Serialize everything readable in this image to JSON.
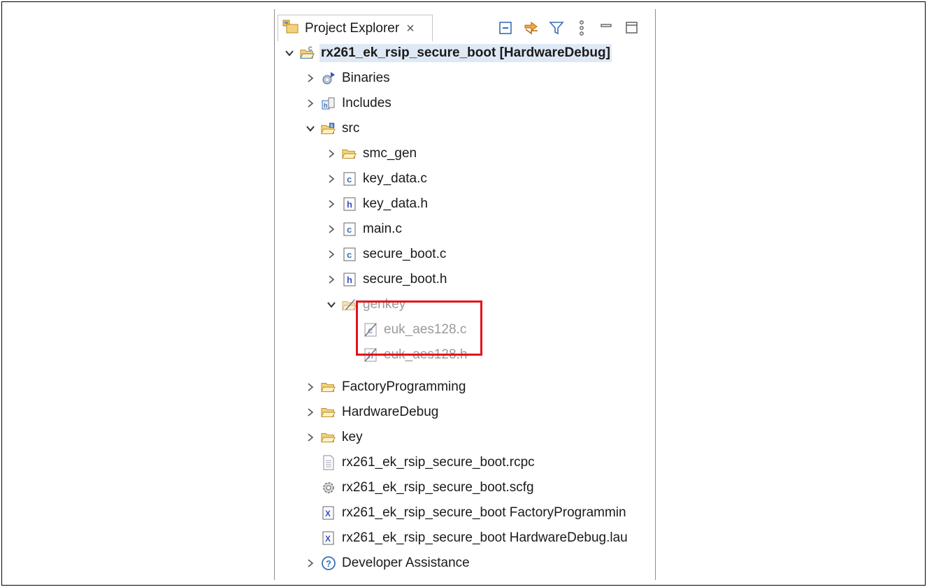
{
  "panel": {
    "tab_title": "Project Explorer",
    "close_glyph": "×",
    "toolbar_icons": [
      "collapse-all-icon",
      "link-with-editor-icon",
      "filter-icon",
      "view-menu-icon",
      "minimize-icon",
      "maximize-icon"
    ]
  },
  "tree": {
    "items": [
      {
        "label": "rx261_ek_rsip_secure_boot [HardwareDebug]",
        "icon": "c-project-icon",
        "expanded": true,
        "selected": true
      },
      {
        "label": "Binaries",
        "icon": "binaries-icon",
        "expanded": false
      },
      {
        "label": "Includes",
        "icon": "includes-icon",
        "expanded": false
      },
      {
        "label": "src",
        "icon": "source-folder-icon",
        "expanded": true
      },
      {
        "label": "smc_gen",
        "icon": "folder-icon",
        "expanded": false
      },
      {
        "label": "key_data.c",
        "icon": "c-file-icon",
        "expanded": false
      },
      {
        "label": "key_data.h",
        "icon": "h-file-icon",
        "expanded": false
      },
      {
        "label": "main.c",
        "icon": "c-file-icon",
        "expanded": false
      },
      {
        "label": "secure_boot.c",
        "icon": "c-file-icon",
        "expanded": false
      },
      {
        "label": "secure_boot.h",
        "icon": "h-file-icon",
        "expanded": false
      },
      {
        "label": "genkey",
        "icon": "excluded-folder-icon",
        "expanded": true,
        "faded": true
      },
      {
        "label": "euk_aes128.c",
        "icon": "excluded-c-file-icon",
        "faded": true
      },
      {
        "label": "euk_aes128.h",
        "icon": "excluded-h-file-icon",
        "faded": true
      },
      {
        "label": "FactoryProgramming",
        "icon": "folder-icon",
        "expanded": false
      },
      {
        "label": "HardwareDebug",
        "icon": "folder-icon",
        "expanded": false
      },
      {
        "label": "key",
        "icon": "folder-icon",
        "expanded": false
      },
      {
        "label": "rx261_ek_rsip_secure_boot.rcpc",
        "icon": "text-file-icon"
      },
      {
        "label": "rx261_ek_rsip_secure_boot.scfg",
        "icon": "config-gear-icon"
      },
      {
        "label": "rx261_ek_rsip_secure_boot FactoryProgrammin",
        "icon": "launch-file-icon"
      },
      {
        "label": "rx261_ek_rsip_secure_boot HardwareDebug.lau",
        "icon": "launch-file-icon"
      },
      {
        "label": "Developer Assistance",
        "icon": "help-icon",
        "expanded": false
      }
    ]
  },
  "colors": {
    "highlight": "#e3121c",
    "selection": "#dfe9f6",
    "folder": "#e8b64a",
    "faded_text": "#9a9a9a"
  }
}
